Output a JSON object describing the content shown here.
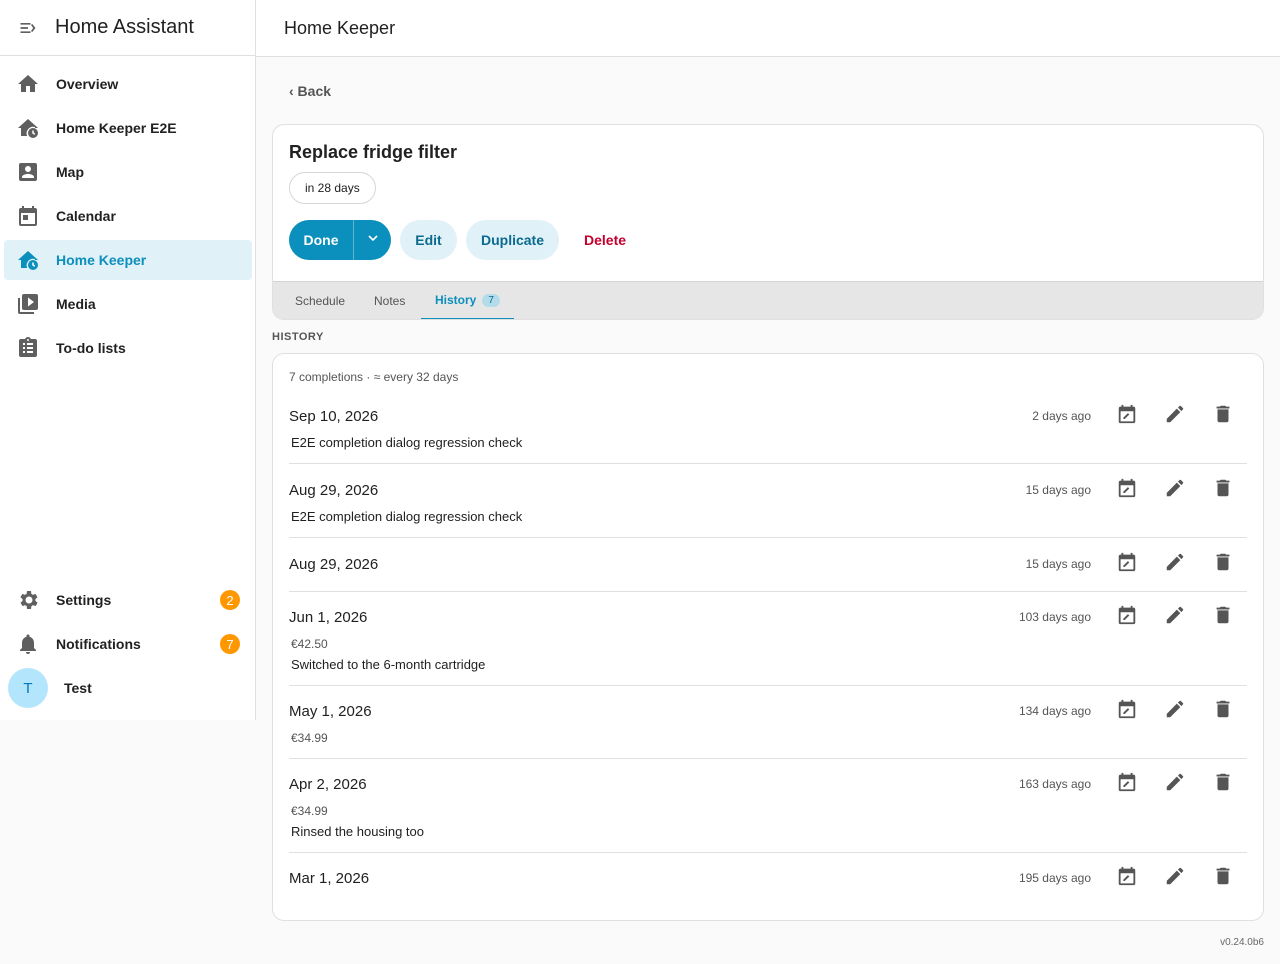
{
  "app": {
    "title": "Home Assistant"
  },
  "sidebar": {
    "items": [
      {
        "label": "Overview",
        "icon": "home-icon"
      },
      {
        "label": "Home Keeper E2E",
        "icon": "home-clock-icon"
      },
      {
        "label": "Map",
        "icon": "account-box-icon"
      },
      {
        "label": "Calendar",
        "icon": "calendar-icon"
      },
      {
        "label": "Home Keeper",
        "icon": "home-clock-icon",
        "active": true
      },
      {
        "label": "Media",
        "icon": "play-box-multiple-icon"
      },
      {
        "label": "To-do lists",
        "icon": "clipboard-list-icon"
      }
    ],
    "settings": {
      "label": "Settings",
      "badge": "2"
    },
    "notifications": {
      "label": "Notifications",
      "badge": "7"
    },
    "user": {
      "initial": "T",
      "name": "Test"
    }
  },
  "header": {
    "title": "Home Keeper"
  },
  "back_label": "‹ Back",
  "task": {
    "title": "Replace fridge filter",
    "due_chip": "in 28 days",
    "actions": {
      "done": "Done",
      "edit": "Edit",
      "duplicate": "Duplicate",
      "delete": "Delete"
    },
    "tabs": [
      {
        "label": "Schedule"
      },
      {
        "label": "Notes"
      },
      {
        "label": "History",
        "count": "7",
        "active": true
      }
    ]
  },
  "history": {
    "section_label": "HISTORY",
    "summary": "7 completions · ≈ every 32 days",
    "entries": [
      {
        "date": "Sep 10, 2026",
        "ago": "2 days ago",
        "cost": "",
        "note": "E2E completion dialog regression check"
      },
      {
        "date": "Aug 29, 2026",
        "ago": "15 days ago",
        "cost": "",
        "note": "E2E completion dialog regression check"
      },
      {
        "date": "Aug 29, 2026",
        "ago": "15 days ago",
        "cost": "",
        "note": ""
      },
      {
        "date": "Jun 1, 2026",
        "ago": "103 days ago",
        "cost": "€42.50",
        "note": "Switched to the 6-month cartridge"
      },
      {
        "date": "May 1, 2026",
        "ago": "134 days ago",
        "cost": "€34.99",
        "note": ""
      },
      {
        "date": "Apr 2, 2026",
        "ago": "163 days ago",
        "cost": "€34.99",
        "note": "Rinsed the housing too"
      },
      {
        "date": "Mar 1, 2026",
        "ago": "195 days ago",
        "cost": "",
        "note": ""
      }
    ]
  },
  "version": "v0.24.0b6",
  "colors": {
    "accent": "#0b8fbd",
    "badge": "#ff9800",
    "danger": "#c5002f"
  }
}
